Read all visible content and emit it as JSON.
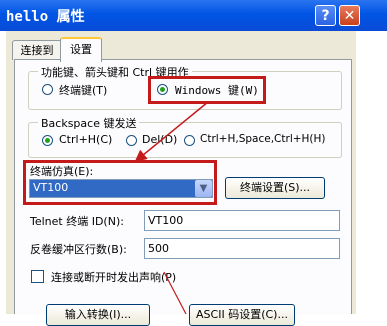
{
  "window": {
    "title": "hello 属性",
    "help_glyph": "?",
    "close_glyph": "✕"
  },
  "tabs": [
    {
      "label": "连接到"
    },
    {
      "label": "设置"
    }
  ],
  "function_keys": {
    "legend": "功能键、箭头键和 Ctrl 键用作",
    "options": [
      {
        "label": "终端键(T)",
        "checked": false
      },
      {
        "label": "Windows 键(W)",
        "checked": true
      }
    ]
  },
  "backspace": {
    "legend": "Backspace 键发送",
    "options": [
      {
        "label": "Ctrl+H(C)",
        "checked": true
      },
      {
        "label": "Del(D)",
        "checked": false
      },
      {
        "label": "Ctrl+H,Space,Ctrl+H(H)",
        "checked": false
      }
    ]
  },
  "emulation": {
    "label": "终端仿真(E):",
    "value": "VT100",
    "setup_button": "终端设置(S)..."
  },
  "telnet_id": {
    "label": "Telnet 终端 ID(N):",
    "value": "VT100"
  },
  "backscroll": {
    "label": "反卷缓冲区行数(B):",
    "value": "500"
  },
  "sound": {
    "label": "连接或断开时发出声响(P)",
    "checked": false
  },
  "bottom_buttons": [
    {
      "label": "输入转换(I)..."
    },
    {
      "label": "ASCII 码设置(C)..."
    }
  ],
  "annotation_color": "#c41a1a"
}
